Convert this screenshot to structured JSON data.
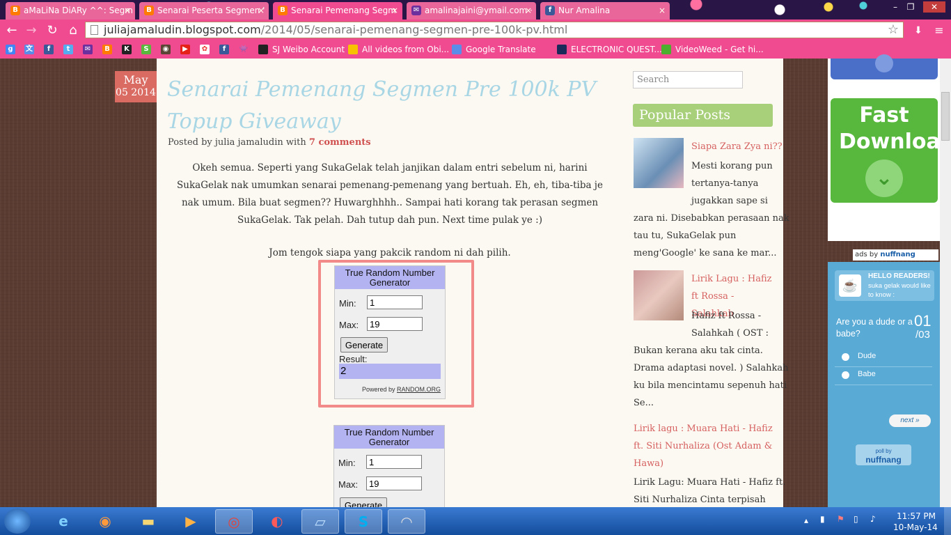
{
  "browser": {
    "tabs": [
      {
        "title": "aMaLiNa DiARy ^^: Segm",
        "icon": "blogger-icon"
      },
      {
        "title": "Senarai Peserta Segmen '",
        "icon": "blogger-icon"
      },
      {
        "title": "Senarai Pemenang Segm",
        "icon": "blogger-icon",
        "active": true
      },
      {
        "title": "amalinajaini@ymail.com ·",
        "icon": "mail-icon"
      },
      {
        "title": "Nur Amalina",
        "icon": "facebook-icon"
      }
    ],
    "url_domain": "juliajamaludin.blogspot.com",
    "url_path": "/2014/05/senarai-pemenang-segmen-pre-100k-pv.html",
    "bookmarks": [
      {
        "label": "SJ Weibo Account"
      },
      {
        "label": "All videos from Obi..."
      },
      {
        "label": "Google Translate"
      },
      {
        "label": "ELECTRONIC QUEST..."
      },
      {
        "label": "VideoWeed - Get hi..."
      }
    ]
  },
  "post": {
    "date_month": "May",
    "date_day": "05 2014",
    "title": "Senarai Pemenang Segmen Pre 100k PV Topup Giveaway",
    "byline_prefix": "Posted by julia jamaludin with",
    "comments": "7 comments",
    "body": "Okeh semua. Seperti yang SukaGelak telah janjikan dalam entri sebelum ni, harini SukaGelak nak umumkan senarai pemenang-pemenang yang bertuah. Eh, eh, tiba-tiba je nak umum. Bila buat segmen?? Huwarghhhh.. Sampai hati korang tak perasan segmen SukaGelak. Tak pelah. Dah tutup dah pun. Next time pulak ye :)",
    "jom": "Jom tengok siapa yang pakcik random ni dah pilih.",
    "rng1": {
      "header": "True Random Number Generator",
      "min_label": "Min:",
      "min": "1",
      "max_label": "Max:",
      "max": "19",
      "button": "Generate",
      "result_label": "Result:",
      "result": "2",
      "powered": "Powered by",
      "powered_link": "RANDOM.ORG"
    },
    "rng2": {
      "header": "True Random Number Generator",
      "min_label": "Min:",
      "min": "1",
      "max_label": "Max:",
      "max": "19",
      "button": "Generate"
    }
  },
  "sidebar": {
    "search_placeholder": "Search",
    "popular_title": "Popular Posts",
    "posts": [
      {
        "title": "Siapa Zara Zya ni??",
        "excerpt_lines": [
          "Mesti korang pun",
          "tertanya-tanya",
          "jugakkan sape si",
          "zara ni. Disebabkan perasaan nak",
          "tau tu, SukaGelak pun",
          "meng'Google' ke sana ke mar..."
        ]
      },
      {
        "title": "Lirik Lagu : Hafiz ft Rossa - Salahkah",
        "excerpt_lines": [
          "Hafiz ft Rossa -",
          "Salahkah ( OST :",
          "Bukan kerana aku tak cinta.",
          "Drama adaptasi novel. ) Salahkah",
          "ku bila mencintamu sepenuh hati",
          "Se..."
        ]
      },
      {
        "title": "Lirik lagu : Muara Hati - Hafiz ft. Siti Nurhaliza (Ost Adam & Hawa)",
        "excerpt_lines": [
          "Lirik Lagu: Muara Hati - Hafiz ft.",
          "Siti Nurhaliza   Cinta terpisah"
        ]
      }
    ]
  },
  "ads": {
    "fast_download": "Fast Download",
    "ads_by": "ads by",
    "brand": "nuffnang",
    "poll": {
      "hello": "HELLO READERS!",
      "sub": "suka gelak would like to know :",
      "question": "Are you a dude or a babe?",
      "counter_top": "01",
      "counter_bottom": "/03",
      "options": [
        "Dude",
        "Babe"
      ],
      "next": "next »",
      "poll_by": "poll by"
    }
  },
  "taskbar": {
    "time": "11:57 PM",
    "date": "10-May-14"
  },
  "colors": {
    "chrome_pink": "#f04a90",
    "title_blue": "#a9d6e5",
    "accent_red": "#d96b63",
    "popular_green": "#a8cf79"
  }
}
